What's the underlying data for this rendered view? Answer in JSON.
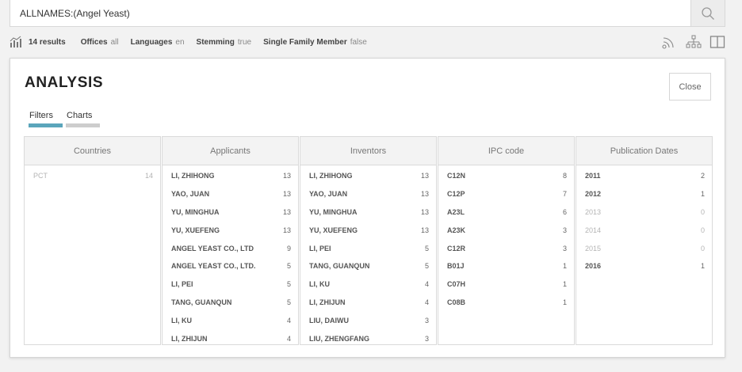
{
  "search": {
    "query": "ALLNAMES:(Angel Yeast)"
  },
  "info": {
    "results": "14 results",
    "offices_label": "Offices",
    "offices_value": "all",
    "languages_label": "Languages",
    "languages_value": "en",
    "stemming_label": "Stemming",
    "stemming_value": "true",
    "sfm_label": "Single Family Member",
    "sfm_value": "false"
  },
  "panel": {
    "title": "ANALYSIS",
    "close_label": "Close",
    "tabs": [
      {
        "label": "Filters",
        "active": true
      },
      {
        "label": "Charts",
        "active": false
      }
    ]
  },
  "columns": [
    {
      "header": "Countries",
      "rows": [
        {
          "label": "PCT",
          "count": "14",
          "muted": true
        }
      ]
    },
    {
      "header": "Applicants",
      "rows": [
        {
          "label": "LI, ZHIHONG",
          "count": "13"
        },
        {
          "label": "YAO, JUAN",
          "count": "13"
        },
        {
          "label": "YU, MINGHUA",
          "count": "13"
        },
        {
          "label": "YU, XUEFENG",
          "count": "13"
        },
        {
          "label": "ANGEL YEAST CO., LTD",
          "count": "9"
        },
        {
          "label": "ANGEL YEAST CO., LTD.",
          "count": "5"
        },
        {
          "label": "LI, PEI",
          "count": "5"
        },
        {
          "label": "TANG, GUANQUN",
          "count": "5"
        },
        {
          "label": "LI, KU",
          "count": "4"
        },
        {
          "label": "LI, ZHIJUN",
          "count": "4"
        }
      ]
    },
    {
      "header": "Inventors",
      "rows": [
        {
          "label": "LI, ZHIHONG",
          "count": "13"
        },
        {
          "label": "YAO, JUAN",
          "count": "13"
        },
        {
          "label": "YU, MINGHUA",
          "count": "13"
        },
        {
          "label": "YU, XUEFENG",
          "count": "13"
        },
        {
          "label": "LI, PEI",
          "count": "5"
        },
        {
          "label": "TANG, GUANQUN",
          "count": "5"
        },
        {
          "label": "LI, KU",
          "count": "4"
        },
        {
          "label": "LI, ZHIJUN",
          "count": "4"
        },
        {
          "label": "LIU, DAIWU",
          "count": "3"
        },
        {
          "label": "LIU, ZHENGFANG",
          "count": "3"
        }
      ]
    },
    {
      "header": "IPC code",
      "rows": [
        {
          "label": "C12N",
          "count": "8"
        },
        {
          "label": "C12P",
          "count": "7"
        },
        {
          "label": "A23L",
          "count": "6"
        },
        {
          "label": "A23K",
          "count": "3"
        },
        {
          "label": "C12R",
          "count": "3"
        },
        {
          "label": "B01J",
          "count": "1"
        },
        {
          "label": "C07H",
          "count": "1"
        },
        {
          "label": "C08B",
          "count": "1"
        }
      ]
    },
    {
      "header": "Publication Dates",
      "rows": [
        {
          "label": "2011",
          "count": "2"
        },
        {
          "label": "2012",
          "count": "1"
        },
        {
          "label": "2013",
          "count": "0",
          "muted": true
        },
        {
          "label": "2014",
          "count": "0",
          "muted": true
        },
        {
          "label": "2015",
          "count": "0",
          "muted": true
        },
        {
          "label": "2016",
          "count": "1"
        }
      ]
    }
  ],
  "icons": {
    "search": "magnifier-icon",
    "results": "bar-chart-icon",
    "rss": "rss-icon",
    "tree": "sitemap-icon",
    "layout": "split-view-icon"
  },
  "colors": {
    "active_tab": "#5ba5bb",
    "inactive_tab": "#cdcdcd"
  }
}
